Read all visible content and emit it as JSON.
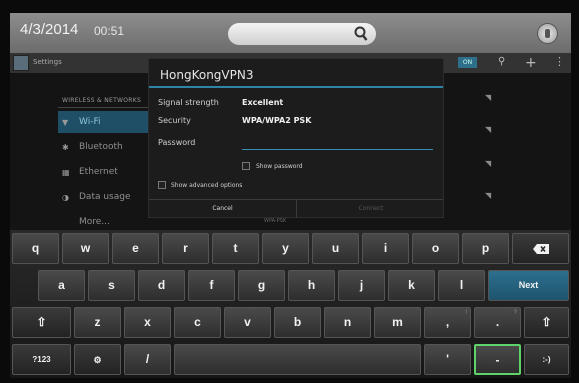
{
  "status_bar": {
    "date": "4/3/2014",
    "time": "00:51"
  },
  "settings": {
    "title": "Settings",
    "section_header": "WIRELESS & NETWORKS",
    "nav_items": [
      {
        "icon": "wifi-icon",
        "glyph": "▼",
        "label": "Wi-Fi"
      },
      {
        "icon": "bluetooth-icon",
        "glyph": "✱",
        "label": "Bluetooth"
      },
      {
        "icon": "ethernet-icon",
        "glyph": "▦",
        "label": "Ethernet"
      },
      {
        "icon": "data-usage-icon",
        "glyph": "◑",
        "label": "Data usage"
      },
      {
        "icon": "",
        "glyph": "",
        "label": "More..."
      }
    ],
    "toggle_label": "ON"
  },
  "dialog": {
    "title": "HongKongVPN3",
    "signal_label": "Signal strength",
    "signal_value": "Excellent",
    "security_label": "Security",
    "security_value": "WPA/WPA2 PSK",
    "password_label": "Password",
    "show_password": "Show password",
    "show_advanced": "Show advanced options",
    "cancel": "Cancel",
    "connect": "Connect"
  },
  "behind_text": "WPA-PSK",
  "keyboard": {
    "row1": [
      "q",
      "w",
      "e",
      "r",
      "t",
      "y",
      "u",
      "i",
      "o",
      "p"
    ],
    "row2": [
      "a",
      "s",
      "d",
      "f",
      "g",
      "h",
      "j",
      "k",
      "l"
    ],
    "row3": [
      "z",
      "x",
      "c",
      "v",
      "b",
      "n",
      "m",
      ",",
      "."
    ],
    "row3_sup": [
      "",
      "",
      "",
      "",
      "",
      "",
      "",
      "!",
      "?"
    ],
    "next_label": "Next",
    "sym_label": "?123",
    "slash": "/",
    "apostrophe": "'",
    "dash": "-",
    "smiley": ":-)"
  },
  "colors": {
    "accent": "#2f84a8",
    "selected_key_border": "#5fd36a"
  }
}
